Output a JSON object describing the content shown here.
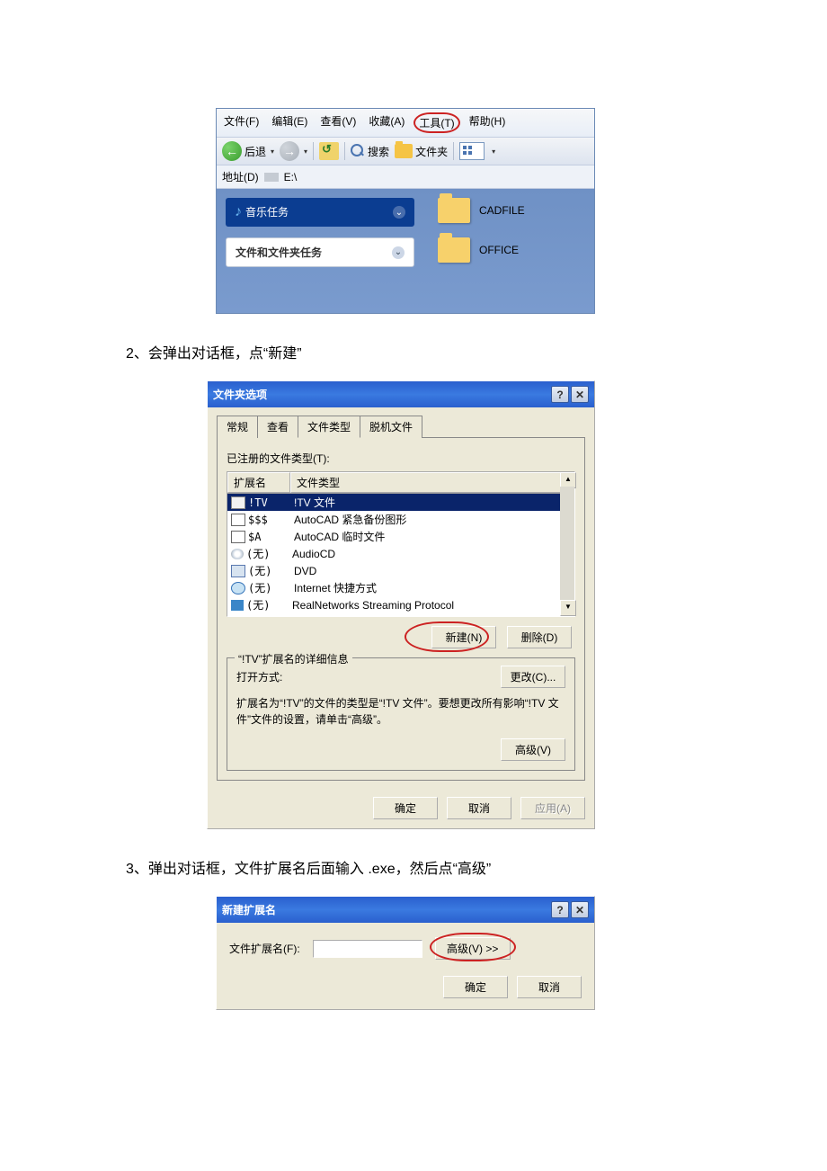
{
  "step2_text": "2、会弹出对话框，点“新建”",
  "step3_text": "3、弹出对话框，文件扩展名后面输入 .exe，然后点“高级”",
  "explorer": {
    "menu": {
      "file": "文件(F)",
      "edit": "编辑(E)",
      "view": "查看(V)",
      "favorites": "收藏(A)",
      "tools": "工具(T)",
      "help": "帮助(H)"
    },
    "toolbar": {
      "back": "后退",
      "search": "搜索",
      "folders": "文件夹"
    },
    "addr_label": "地址(D)",
    "addr_value": "E:\\",
    "task_music": "音乐任务",
    "task_files": "文件和文件夹任务",
    "folders_list": [
      {
        "name": "CADFILE"
      },
      {
        "name": "OFFICE"
      }
    ]
  },
  "folder_options": {
    "title": "文件夹选项",
    "tabs": {
      "general": "常规",
      "view": "查看",
      "types": "文件类型",
      "offline": "脱机文件"
    },
    "label_registered": "已注册的文件类型(T):",
    "col_ext": "扩展名",
    "col_type": "文件类型",
    "rows": [
      {
        "ext": "!TV",
        "type": "!TV 文件",
        "selected": true
      },
      {
        "ext": "$$$",
        "type": "AutoCAD 紧急备份图形"
      },
      {
        "ext": "$A",
        "type": "AutoCAD 临时文件"
      },
      {
        "ext": "(无)",
        "type": "AudioCD"
      },
      {
        "ext": "(无)",
        "type": "DVD"
      },
      {
        "ext": "(无)",
        "type": "Internet 快捷方式"
      },
      {
        "ext": "(无)",
        "type": "RealNetworks Streaming Protocol"
      }
    ],
    "btn_new": "新建(N)",
    "btn_delete": "删除(D)",
    "group_title": "“!TV”扩展名的详细信息",
    "open_with_label": "打开方式:",
    "btn_change": "更改(C)...",
    "desc": "扩展名为“!TV”的文件的类型是“!TV 文件”。要想更改所有影响“!TV 文件”文件的设置，请单击“高级”。",
    "btn_advanced": "高级(V)",
    "btn_ok": "确定",
    "btn_cancel": "取消",
    "btn_apply": "应用(A)"
  },
  "new_ext": {
    "title": "新建扩展名",
    "label": "文件扩展名(F):",
    "btn_advanced": "高级(V) >>",
    "btn_ok": "确定",
    "btn_cancel": "取消"
  }
}
